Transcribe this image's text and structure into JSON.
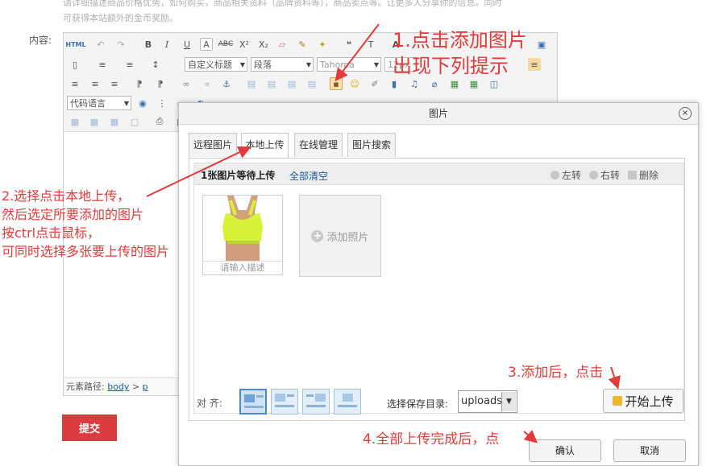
{
  "page": {
    "hint_lines": [
      "请详细描述商品价格优势，如何购买，商品相关资料（品牌资料等），商品卖点等。让更多人分享你的信息。同时",
      "可获得本站额外的金币奖励。"
    ],
    "content_label": "内容:",
    "submit_label": "提交"
  },
  "editor": {
    "html_label": "HTML",
    "custom_title": "自定义标题",
    "paragraph": "段落",
    "font": "Tahoma",
    "font_size": "12px",
    "code_lang": "代码语言",
    "element_path_label": "元素路径:",
    "path_body": "body",
    "path_sep": ">",
    "path_p": "p"
  },
  "dialog": {
    "title": "图片",
    "close": "×",
    "tabs": [
      "远程图片",
      "本地上传",
      "在线管理",
      "图片搜索"
    ],
    "queue_count": "1张图片等待上传",
    "clear_all": "全部清空",
    "rotate_left": "左转",
    "rotate_right": "右转",
    "delete": "删除",
    "desc_placeholder": "请输入描述",
    "add_photo": "添加照片",
    "align_label": "对 齐:",
    "save_dir_label": "选择保存目录:",
    "save_dir_value": "uploads",
    "start_upload": "开始上传",
    "confirm": "确认",
    "cancel": "取消"
  },
  "annotations": {
    "step1_a": "1.点击添加图片",
    "step1_b": "出现下列提示",
    "step2_a": "2.选择点击本地上传，",
    "step2_b": "然后选定所要添加的图片",
    "step2_c": "按ctrl点击鼠标，",
    "step2_d": "可同时选择多张要上传的图片",
    "step3": "3.添加后，点击",
    "step4": "4.全部上传完成后，点"
  },
  "colors": {
    "annotation": "#e53a3a",
    "submit": "#dc3b3f",
    "link": "#1a5aa0"
  }
}
